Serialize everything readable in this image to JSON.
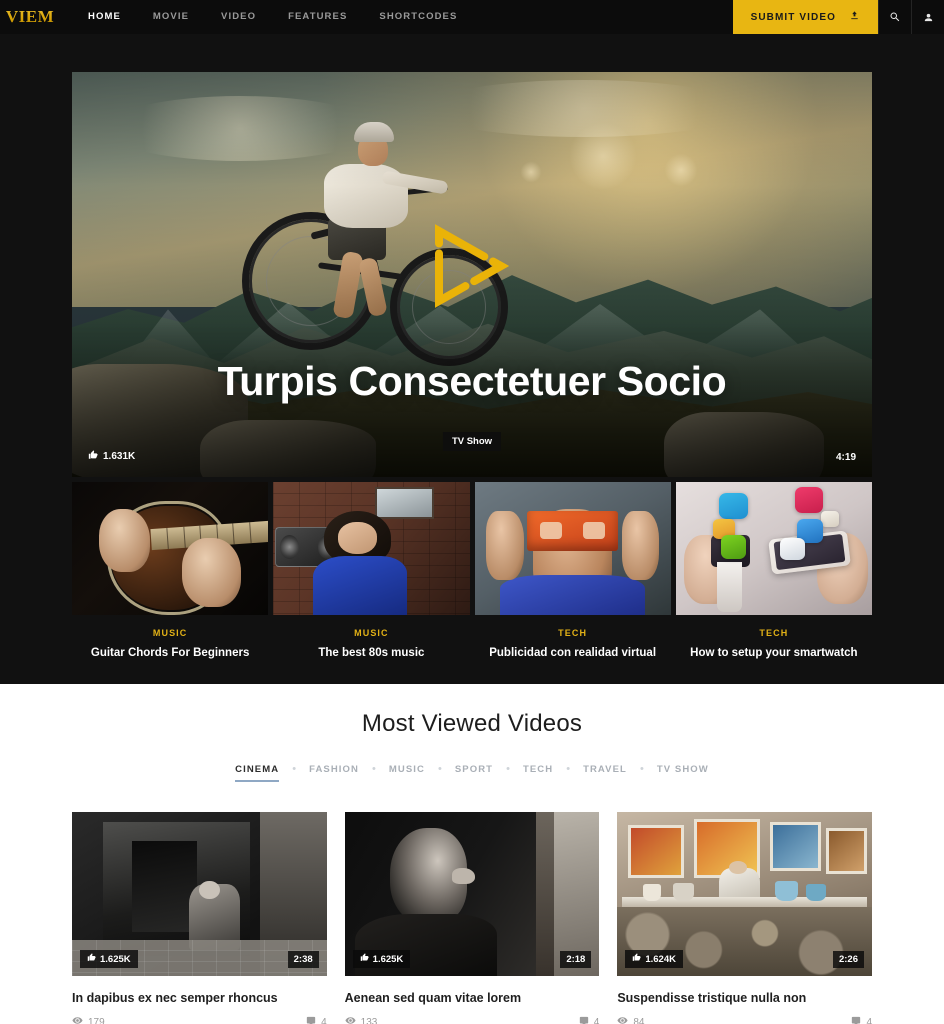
{
  "brand": {
    "logo_text": "VIEM",
    "accent": "#e8b612",
    "dark": "#111111"
  },
  "nav": {
    "items": [
      {
        "label": "HOME",
        "active": true
      },
      {
        "label": "MOVIE",
        "active": false
      },
      {
        "label": "VIDEO",
        "active": false
      },
      {
        "label": "FEATURES",
        "active": false
      },
      {
        "label": "SHORTCODES",
        "active": false
      }
    ],
    "submit_label": "SUBMIT VIDEO",
    "submit_icon": "upload-icon",
    "search_icon": "search-icon",
    "account_icon": "user-icon"
  },
  "hero": {
    "title": "Turpis Consectetuer Socio",
    "category": "TV Show",
    "likes": "1.631K",
    "likes_icon": "thumbs-up-icon",
    "duration": "4:19",
    "play_icon": "play-triangle-icon"
  },
  "strip": [
    {
      "category": "MUSIC",
      "title": "Guitar Chords For Beginners",
      "art": "guitar"
    },
    {
      "category": "MUSIC",
      "title": "The best 80s music",
      "art": "80s"
    },
    {
      "category": "TECH",
      "title": "Publicidad con realidad virtual",
      "art": "vr"
    },
    {
      "category": "TECH",
      "title": "How to setup your smartwatch",
      "art": "watch"
    }
  ],
  "most_viewed": {
    "title": "Most Viewed Videos",
    "filters": [
      {
        "label": "CINEMA",
        "active": true
      },
      {
        "label": "FASHION",
        "active": false
      },
      {
        "label": "MUSIC",
        "active": false
      },
      {
        "label": "SPORT",
        "active": false
      },
      {
        "label": "TECH",
        "active": false
      },
      {
        "label": "TRAVEL",
        "active": false
      },
      {
        "label": "TV SHOW",
        "active": false
      }
    ],
    "active_underline_color": "#8fa8c4",
    "cards": [
      {
        "title": "In dapibus ex nec semper rhoncus",
        "likes": "1.625K",
        "duration": "2:38",
        "views": "179",
        "comments": "4",
        "views_icon": "eye-icon",
        "comments_icon": "comment-icon",
        "likes_icon": "thumbs-up-icon"
      },
      {
        "title": "Aenean sed quam vitae lorem",
        "likes": "1.625K",
        "duration": "2:18",
        "views": "133",
        "comments": "4",
        "views_icon": "eye-icon",
        "comments_icon": "comment-icon",
        "likes_icon": "thumbs-up-icon"
      },
      {
        "title": "Suspendisse tristique nulla non",
        "likes": "1.624K",
        "duration": "2:26",
        "views": "84",
        "comments": "4",
        "views_icon": "eye-icon",
        "comments_icon": "comment-icon",
        "likes_icon": "thumbs-up-icon"
      }
    ]
  }
}
